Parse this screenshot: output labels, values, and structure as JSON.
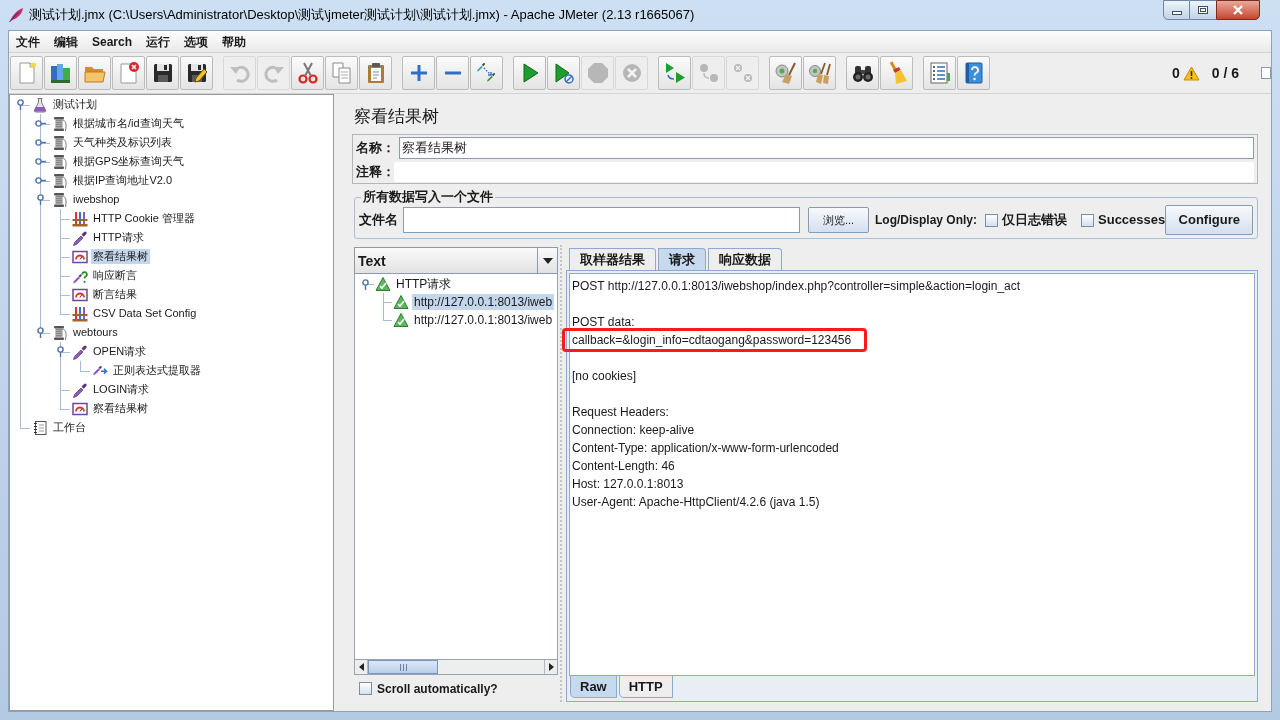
{
  "window": {
    "title": "测试计划.jmx (C:\\Users\\Administrator\\Desktop\\测试\\jmeter测试计划\\测试计划.jmx) - Apache JMeter (2.13 r1665067)"
  },
  "menu": [
    "文件",
    "编辑",
    "Search",
    "运行",
    "选项",
    "帮助"
  ],
  "toolbar": [
    [
      {
        "kind": "new",
        "disabled": false
      },
      {
        "kind": "templates",
        "disabled": false
      },
      {
        "kind": "open",
        "disabled": false
      },
      {
        "kind": "close",
        "disabled": false
      },
      {
        "kind": "save",
        "disabled": false
      },
      {
        "kind": "saveas",
        "disabled": false
      }
    ],
    [
      {
        "kind": "undo",
        "disabled": true
      },
      {
        "kind": "redo",
        "disabled": true
      },
      {
        "kind": "cut",
        "disabled": false
      },
      {
        "kind": "copy",
        "disabled": false
      },
      {
        "kind": "paste",
        "disabled": false
      }
    ],
    [
      {
        "kind": "expand",
        "disabled": false
      },
      {
        "kind": "collapse",
        "disabled": false
      },
      {
        "kind": "toggle",
        "disabled": false
      }
    ],
    [
      {
        "kind": "start",
        "disabled": false
      },
      {
        "kind": "startnopause",
        "disabled": false
      },
      {
        "kind": "stop",
        "disabled": true
      },
      {
        "kind": "shutdown",
        "disabled": true
      }
    ],
    [
      {
        "kind": "remotestart",
        "disabled": false
      },
      {
        "kind": "remotestop",
        "disabled": true
      },
      {
        "kind": "remoteshutdown",
        "disabled": true
      }
    ],
    [
      {
        "kind": "clear",
        "disabled": false
      },
      {
        "kind": "clearall",
        "disabled": false
      }
    ],
    [
      {
        "kind": "search",
        "disabled": false
      },
      {
        "kind": "resetsearch",
        "disabled": false
      }
    ],
    [
      {
        "kind": "functions",
        "disabled": false
      },
      {
        "kind": "help",
        "disabled": false
      }
    ]
  ],
  "status": {
    "warnings": "0",
    "threads": "0 / 6"
  },
  "tree": [
    {
      "label": "测试计划",
      "kind": "plan",
      "expanded": true,
      "selected": false,
      "children": [
        {
          "label": "根据城市名/id查询天气",
          "kind": "threadgroup",
          "expanded": false,
          "selected": false
        },
        {
          "label": "天气种类及标识列表",
          "kind": "threadgroup",
          "expanded": false,
          "selected": false
        },
        {
          "label": "根据GPS坐标查询天气",
          "kind": "threadgroup",
          "expanded": false,
          "selected": false
        },
        {
          "label": "根据IP查询地址V2.0",
          "kind": "threadgroup",
          "expanded": false,
          "selected": false
        },
        {
          "label": "iwebshop",
          "kind": "threadgroup",
          "expanded": true,
          "selected": false,
          "children": [
            {
              "label": "HTTP Cookie 管理器",
              "kind": "config",
              "selected": false
            },
            {
              "label": "HTTP请求",
              "kind": "sampler",
              "selected": false
            },
            {
              "label": "察看结果树",
              "kind": "listener",
              "selected": true
            },
            {
              "label": "响应断言",
              "kind": "assertion",
              "selected": false
            },
            {
              "label": "断言结果",
              "kind": "listener",
              "selected": false
            },
            {
              "label": "CSV Data Set Config",
              "kind": "config",
              "selected": false
            }
          ]
        },
        {
          "label": "webtours",
          "kind": "threadgroup",
          "expanded": true,
          "selected": false,
          "children": [
            {
              "label": "OPEN请求",
              "kind": "sampler",
              "expanded": true,
              "selected": false,
              "children": [
                {
                  "label": "正则表达式提取器",
                  "kind": "extractor",
                  "selected": false
                }
              ]
            },
            {
              "label": "LOGIN请求",
              "kind": "sampler",
              "selected": false
            },
            {
              "label": "察看结果树",
              "kind": "listener",
              "selected": false
            }
          ]
        }
      ]
    },
    {
      "label": "工作台",
      "kind": "workbench",
      "selected": false
    }
  ],
  "panel": {
    "title": "察看结果树",
    "name": {
      "label": "名称：",
      "value": "察看结果树"
    },
    "comment": {
      "label": "注释："
    },
    "file": {
      "legend": "所有数据写入一个文件",
      "label": "文件名",
      "browse": "浏览...",
      "log_label": "Log/Display Only:",
      "options": [
        {
          "label": "仅日志错误",
          "checked": false
        },
        {
          "label": "Successes",
          "checked": false
        }
      ],
      "configure": "Configure"
    },
    "results": {
      "renderer": "Text",
      "tree": [
        {
          "label": "HTTP请求",
          "success": true,
          "expanded": true,
          "selected": false,
          "children": [
            {
              "label": "http://127.0.0.1:8013/iweb",
              "success": true,
              "selected": true
            },
            {
              "label": "http://127.0.0.1:8013/iweb",
              "success": true,
              "selected": false
            }
          ]
        }
      ],
      "scroll_automatically": {
        "label": "Scroll automatically?",
        "checked": false
      },
      "tabs": [
        {
          "label": "取样器结果",
          "selected": false
        },
        {
          "label": "请求",
          "selected": true
        },
        {
          "label": "响应数据",
          "selected": false
        }
      ],
      "request": [
        [
          {
            "text": "POST http://127.0.0.1:8013/iwebshop/index.php?controller=simple&action=login_act",
            "highlighted": false
          }
        ],
        [
          {
            "text": "POST data:",
            "highlighted": false
          },
          {
            "text": "callback=&login_info=cdtaogang&password=123456",
            "highlighted": true
          }
        ],
        [
          {
            "text": "[no cookies]",
            "highlighted": false
          }
        ],
        [
          {
            "text": "Request Headers:",
            "highlighted": false
          },
          {
            "text": "Connection: keep-alive",
            "highlighted": false
          },
          {
            "text": "Content-Type: application/x-www-form-urlencoded",
            "highlighted": false
          },
          {
            "text": "Content-Length: 46",
            "highlighted": false
          },
          {
            "text": "Host: 127.0.0.1:8013",
            "highlighted": false
          },
          {
            "text": "User-Agent: Apache-HttpClient/4.2.6 (java 1.5)",
            "highlighted": false
          }
        ]
      ],
      "view_tabs": [
        {
          "label": "Raw",
          "selected": true
        },
        {
          "label": "HTTP",
          "selected": false
        }
      ]
    }
  }
}
